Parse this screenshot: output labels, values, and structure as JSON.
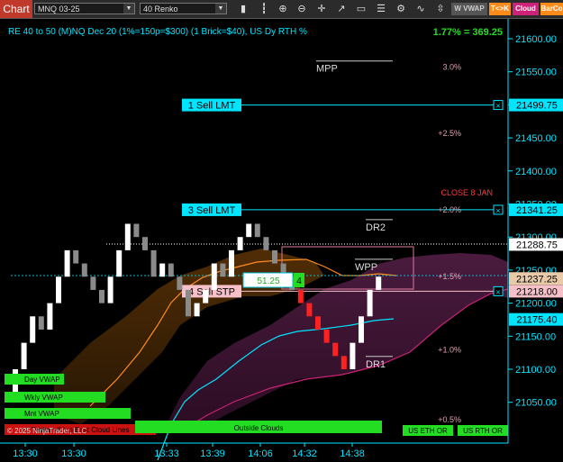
{
  "toolbar": {
    "app_label": "Chart",
    "instrument": "MNQ 03-25",
    "bar_type": "40 Renko",
    "icons": [
      "dropdown-icon",
      "bar-chart-icon",
      "zoom-in-icon",
      "zoom-out-icon",
      "crosshair-icon",
      "drawing-icon",
      "draw-tools-icon",
      "properties-icon",
      "strategy-icon",
      "indicator-icon",
      "scroll-icon",
      "notes-icon"
    ],
    "btn_wvwap": "W VWAP",
    "btn_tk": "T<>K",
    "btn_cloud": "Cloud",
    "btn_barco": "BarCo"
  },
  "header": {
    "title": "RE 40 to 50 (M)NQ Dec 20 (1%=150p=$300) (1 Brick=$40), US Dy RTH %",
    "perf": "1.77% = 369.25"
  },
  "colors": {
    "cyan": "#00e5ff",
    "orange": "#ff8c1a",
    "green": "#22dd22",
    "magenta": "#cc2277"
  },
  "chart_data": {
    "type": "renko",
    "ylim": [
      21050,
      21650
    ],
    "x_ticks": [
      "13:30",
      "13:30",
      "13:33",
      "13:39",
      "14:06",
      "14:32",
      "14:38"
    ],
    "y_ticks": [
      "21600.00",
      "21550.00",
      "21500.00",
      "21450.00",
      "21400.00",
      "21350.00",
      "21300.00",
      "21250.00",
      "21200.00",
      "21150.00",
      "21100.00",
      "21050.00"
    ],
    "price_labels": [
      {
        "name": "sell-1-lmt",
        "label": "1 Sell LMT",
        "price": 21499.75,
        "value": "21499.75"
      },
      {
        "name": "sell-3-lmt",
        "label": "3 Sell LMT",
        "price": 21341.25,
        "value": "21341.25"
      },
      {
        "name": "last-price",
        "label": "",
        "price": 21288.75,
        "value": "21288.75"
      },
      {
        "name": "entry",
        "label": "",
        "price": 21237.25,
        "value": "21237.25"
      },
      {
        "name": "sell-4-stp",
        "label": "4 Sell STP",
        "price": 21218.0,
        "value": "21218.00"
      },
      {
        "name": "cloud-value",
        "label": "",
        "price": 21175.4,
        "value": "21175.40"
      }
    ],
    "pct_labels": [
      {
        "text": "3.0%",
        "price": 21557
      },
      {
        "text": "+2.5%",
        "price": 21457
      },
      {
        "text": "+2.0%",
        "price": 21341
      },
      {
        "text": "+1.5%",
        "price": 21240
      },
      {
        "text": "+1.0%",
        "price": 21129
      },
      {
        "text": "+0.5%",
        "price": 21024
      }
    ],
    "levels": [
      {
        "text": "MPP",
        "price": 21550
      },
      {
        "text": "DR2",
        "price": 21310
      },
      {
        "text": "WPP",
        "price": 21250
      },
      {
        "text": "DR1",
        "price": 21103
      }
    ],
    "close_label": {
      "text": "CLOSE 8 JAN",
      "price": 21367
    },
    "position": {
      "price_text": "51.25",
      "qty": "4"
    },
    "renko_closes": [
      21100,
      21140,
      21180,
      21160,
      21200,
      21240,
      21280,
      21260,
      21240,
      21220,
      21200,
      21240,
      21280,
      21320,
      21300,
      21280,
      21240,
      21260,
      21240,
      21220,
      21180,
      21200,
      21220,
      21260,
      21240,
      21280,
      21300,
      21320,
      21300,
      21280,
      21260,
      21240,
      21220,
      21200,
      21180,
      21160,
      21140,
      21120,
      21100,
      21140,
      21180,
      21220,
      21240
    ],
    "indicator_bars": [
      {
        "label": "Day VWAP",
        "color": "#22dd22"
      },
      {
        "label": "Wkly VWAP",
        "color": "#22dd22"
      },
      {
        "label": "Mnt VWAP",
        "color": "#22dd22"
      },
      {
        "label": "Tenkan-Kijun East Cloud Lines",
        "color": "#cc1111"
      },
      {
        "label": "Outside Clouds",
        "color": "#22dd22"
      },
      {
        "label": "US ETH OR",
        "color": "#22dd22"
      },
      {
        "label": "US RTH OR",
        "color": "#22dd22"
      }
    ],
    "copyright": "© 2025 NinjaTrader, LLC"
  }
}
